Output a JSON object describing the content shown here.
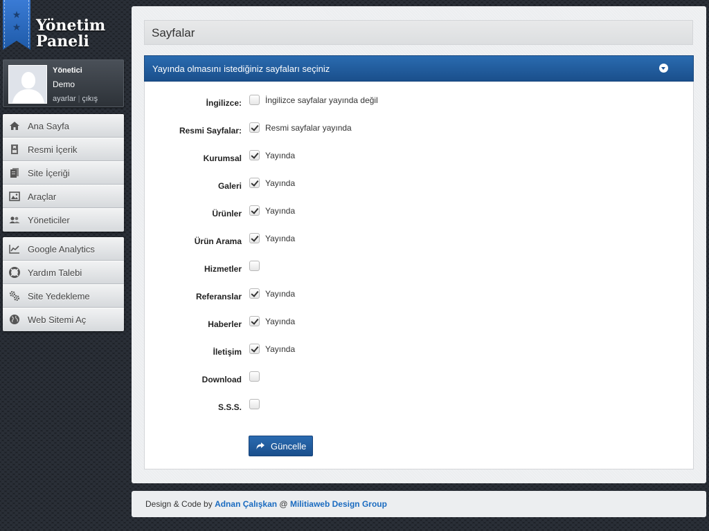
{
  "logo": {
    "title": "Yönetim\nPaneli"
  },
  "profile": {
    "role": "Yönetici",
    "name": "Demo",
    "settings_link": "ayarlar",
    "separator": "|",
    "logout_link": "çıkış"
  },
  "menu_primary": [
    {
      "label": "Ana Sayfa",
      "icon": "home-icon"
    },
    {
      "label": "Resmi İçerik",
      "icon": "document-icon"
    },
    {
      "label": "Site İçeriği",
      "icon": "pages-icon"
    },
    {
      "label": "Araçlar",
      "icon": "image-icon"
    },
    {
      "label": "Yöneticiler",
      "icon": "users-icon"
    }
  ],
  "menu_secondary": [
    {
      "label": "Google Analytics",
      "icon": "chart-icon"
    },
    {
      "label": "Yardım Talebi",
      "icon": "lifebuoy-icon"
    },
    {
      "label": "Site Yedekleme",
      "icon": "gears-icon"
    },
    {
      "label": "Web Sitemi Aç",
      "icon": "globe-icon"
    }
  ],
  "page": {
    "title": "Sayfalar",
    "box_title": "Yayında olmasını istediğiniz sayfaları seçiniz"
  },
  "form": {
    "rows": [
      {
        "label": "İngilizce:",
        "checked": false,
        "text": "İngilizce sayfalar yayında değil"
      },
      {
        "label": "Resmi Sayfalar:",
        "checked": true,
        "text": "Resmi sayfalar yayında"
      },
      {
        "label": "Kurumsal",
        "checked": true,
        "text": "Yayında"
      },
      {
        "label": "Galeri",
        "checked": true,
        "text": "Yayında"
      },
      {
        "label": "Ürünler",
        "checked": true,
        "text": "Yayında"
      },
      {
        "label": "Ürün Arama",
        "checked": true,
        "text": "Yayında"
      },
      {
        "label": "Hizmetler",
        "checked": false,
        "text": ""
      },
      {
        "label": "Referanslar",
        "checked": true,
        "text": "Yayında"
      },
      {
        "label": "Haberler",
        "checked": true,
        "text": "Yayında"
      },
      {
        "label": "İletişim",
        "checked": true,
        "text": "Yayında"
      },
      {
        "label": "Download",
        "checked": false,
        "text": ""
      },
      {
        "label": "S.S.S.",
        "checked": false,
        "text": ""
      }
    ],
    "submit_label": "Güncelle"
  },
  "footer": {
    "prefix": "Design & Code by ",
    "author": "Adnan Çalışkan",
    "at": " @ ",
    "company": "Militiaweb Design Group"
  },
  "colors": {
    "accent": "#1e5aa0",
    "link": "#1a6bc0",
    "background": "#1c2026"
  }
}
